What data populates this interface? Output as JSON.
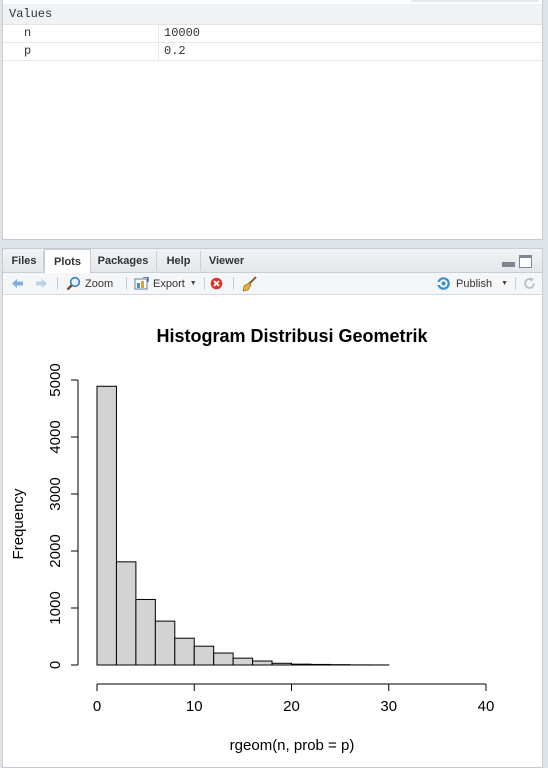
{
  "environment": {
    "section_label": "Values",
    "variables": [
      {
        "name": "n",
        "value": "10000"
      },
      {
        "name": "p",
        "value": "0.2"
      }
    ]
  },
  "pane": {
    "tabs": [
      "Files",
      "Plots",
      "Packages",
      "Help",
      "Viewer"
    ],
    "active_tab": "Plots",
    "toolbar": {
      "back_icon": "arrow-left-icon",
      "forward_icon": "arrow-right-icon",
      "zoom_label": "Zoom",
      "export_label": "Export",
      "remove_icon": "remove-plot-icon",
      "clear_icon": "broom-icon",
      "publish_label": "Publish",
      "refresh_icon": "refresh-icon"
    }
  },
  "colors": {
    "accent": "#4a90c8",
    "bar_fill": "#d3d3d3",
    "remove_red": "#d9342b"
  },
  "chart_data": {
    "type": "bar",
    "title": "Histogram Distribusi Geometrik",
    "xlabel": "rgeom(n, prob = p)",
    "ylabel": "Frequency",
    "bin_edges": [
      0,
      2,
      4,
      6,
      8,
      10,
      12,
      14,
      16,
      18,
      20,
      22,
      24,
      26,
      28,
      30,
      32,
      34,
      36,
      38,
      40
    ],
    "values": [
      4890,
      1810,
      1150,
      770,
      470,
      330,
      210,
      120,
      70,
      30,
      15,
      10,
      6,
      2,
      1,
      0,
      0,
      0,
      0,
      0
    ],
    "xlim": [
      0,
      40
    ],
    "ylim": [
      0,
      5000
    ],
    "x_ticks": [
      0,
      10,
      20,
      30,
      40
    ],
    "y_ticks": [
      0,
      1000,
      2000,
      3000,
      4000,
      5000
    ],
    "grid": false
  }
}
